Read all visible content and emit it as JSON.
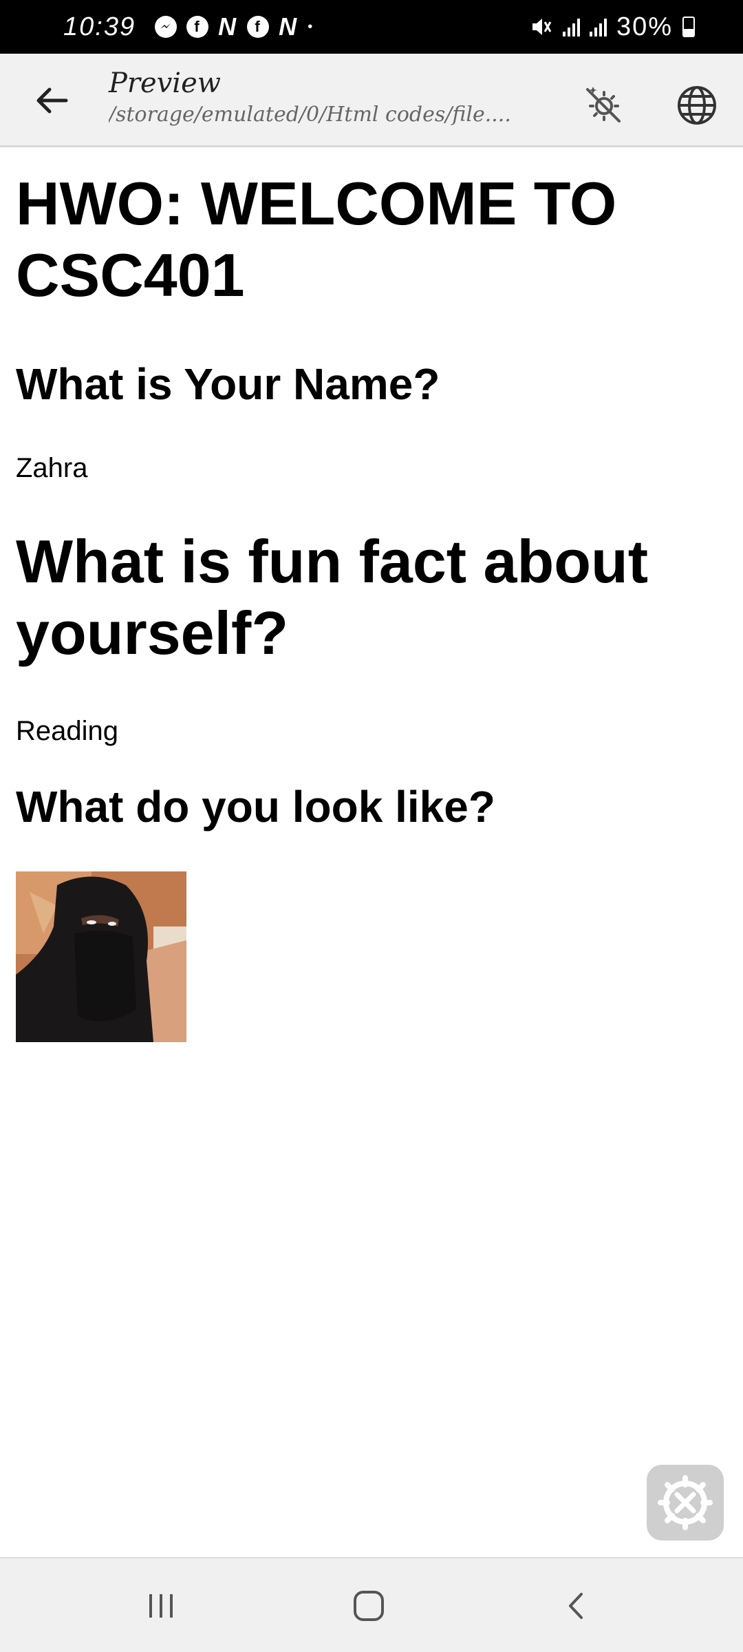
{
  "status_bar": {
    "time": "10:39",
    "app_icons": [
      "messenger-icon",
      "facebook-icon",
      "n-app-icon",
      "facebook-icon",
      "n-app-icon"
    ],
    "n_glyph": "N",
    "f_glyph": "f",
    "dot": "•",
    "battery_percent": "30%"
  },
  "app_bar": {
    "title": "Preview",
    "subtitle": "/storage/emulated/0/Html codes/file...."
  },
  "page": {
    "heading_main": "HWO: WELCOME TO CSC401",
    "q_name": "What is Your Name?",
    "a_name": "Zahra",
    "q_fact": "What is fun fact about yourself?",
    "a_fact": "Reading",
    "q_look": "What do you look like?"
  },
  "colors": {
    "app_bar_bg": "#f1f1f1",
    "status_bar_bg": "#000000",
    "fab_bg": "#cfcfcf"
  }
}
